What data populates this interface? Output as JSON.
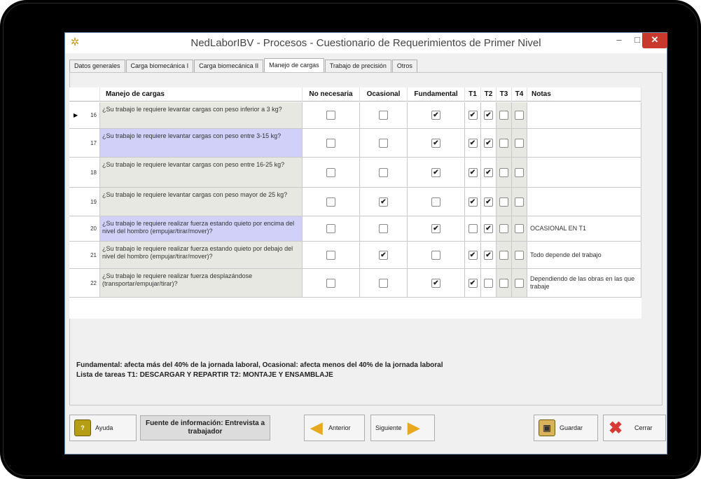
{
  "window": {
    "title": "NedLaborIBV - Procesos - Cuestionario de Requerimientos de Primer Nivel",
    "min": "–",
    "max": "□",
    "close": "✕"
  },
  "tabs": [
    "Datos generales",
    "Carga biomecánica I",
    "Carga biomecánica II",
    "Manejo de cargas",
    "Trabajo de precisión",
    "Otros"
  ],
  "active_tab": "Manejo de cargas",
  "columns": [
    "Manejo de cargas",
    "No necesaria",
    "Ocasional",
    "Fundamental",
    "T1",
    "T2",
    "T3",
    "T4",
    "Notas"
  ],
  "rows": [
    {
      "num": "16",
      "question": "¿Su trabajo le requiere levantar cargas con peso inferior a 3 kg?",
      "nn": false,
      "oc": false,
      "fu": true,
      "t1": true,
      "t2": true,
      "t3": false,
      "t4": false,
      "note": "",
      "hl": false,
      "current": true
    },
    {
      "num": "17",
      "question": "¿Su trabajo le requiere levantar cargas con peso entre 3-15 kg?",
      "nn": false,
      "oc": false,
      "fu": true,
      "t1": true,
      "t2": true,
      "t3": false,
      "t4": false,
      "note": "",
      "hl": true,
      "current": false
    },
    {
      "num": "18",
      "question": "¿Su trabajo le requiere levantar cargas con peso entre 16-25 kg?",
      "nn": false,
      "oc": false,
      "fu": true,
      "t1": true,
      "t2": true,
      "t3": false,
      "t4": false,
      "note": "",
      "hl": false,
      "current": false
    },
    {
      "num": "19",
      "question": "¿Su trabajo le requiere levantar cargas con peso mayor de 25 kg?",
      "nn": false,
      "oc": true,
      "fu": false,
      "t1": true,
      "t2": true,
      "t3": false,
      "t4": false,
      "note": "",
      "hl": false,
      "current": false
    },
    {
      "num": "20",
      "question": "¿Su trabajo le requiere realizar fuerza estando quieto por encima del nivel del hombro (empujar/tirar/mover)?",
      "nn": false,
      "oc": false,
      "fu": true,
      "t1": false,
      "t2": true,
      "t3": false,
      "t4": false,
      "note": "OCASIONAL EN T1",
      "hl": true,
      "current": false
    },
    {
      "num": "21",
      "question": "¿Su trabajo le requiere realizar fuerza estando quieto por debajo del nivel del hombro (empujar/tirar/mover)?",
      "nn": false,
      "oc": true,
      "fu": false,
      "t1": true,
      "t2": true,
      "t3": false,
      "t4": false,
      "note": "Todo depende del trabajo",
      "hl": false,
      "current": false
    },
    {
      "num": "22",
      "question": "¿Su trabajo le requiere realizar fuerza desplazándose (transportar/empujar/tirar)?",
      "nn": false,
      "oc": false,
      "fu": true,
      "t1": true,
      "t2": false,
      "t3": false,
      "t4": false,
      "note": "Dependiendo de las obras en las que trabaje",
      "hl": false,
      "current": false
    }
  ],
  "legend": {
    "line1": "Fundamental: afecta más del 40% de la jornada laboral, Ocasional: afecta menos del 40% de la jornada laboral",
    "line2": "Lista de tareas T1: DESCARGAR Y REPARTIR T2: MONTAJE Y ENSAMBLAJE"
  },
  "buttons": {
    "help": "Ayuda",
    "source": "Fuente de información: Entrevista a trabajador",
    "prev": "Anterior",
    "next": "Siguiente",
    "save": "Guardar",
    "close": "Cerrar"
  },
  "colors": {
    "highlight": "#d0d0f8",
    "question_bg": "#e8e8e3",
    "help_icon": "#b59e16",
    "arrow_icon": "#e8a91f",
    "close_icon": "#d63b36"
  },
  "icons": {
    "app": "gear-icon",
    "help": "question-icon",
    "prev": "left-arrow-icon",
    "next": "right-arrow-icon",
    "save": "floppy-icon",
    "close": "x-icon"
  }
}
